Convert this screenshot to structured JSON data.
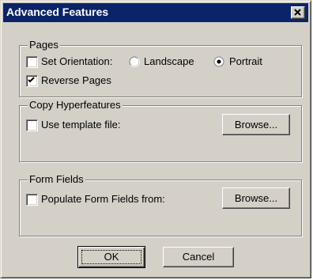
{
  "window": {
    "title": "Advanced Features"
  },
  "pages": {
    "group_label": "Pages",
    "set_orientation_label": "Set Orientation:",
    "set_orientation_checked": false,
    "landscape_label": "Landscape",
    "portrait_label": "Portrait",
    "selected_orientation": "Portrait",
    "reverse_pages_label": "Reverse Pages",
    "reverse_pages_checked": true
  },
  "copy_hyperfeatures": {
    "group_label": "Copy Hyperfeatures",
    "use_template_label": "Use template file:",
    "use_template_checked": false,
    "browse_label": "Browse..."
  },
  "form_fields": {
    "group_label": "Form Fields",
    "populate_label": "Populate Form Fields from:",
    "populate_checked": false,
    "browse_label": "Browse..."
  },
  "buttons": {
    "ok_label": "OK",
    "cancel_label": "Cancel"
  },
  "icons": {
    "close": "close-icon",
    "check": "checkmark-icon",
    "radio": "radio-icon"
  },
  "colors": {
    "titlebar": "#0a246a",
    "face": "#d4d0c8"
  }
}
